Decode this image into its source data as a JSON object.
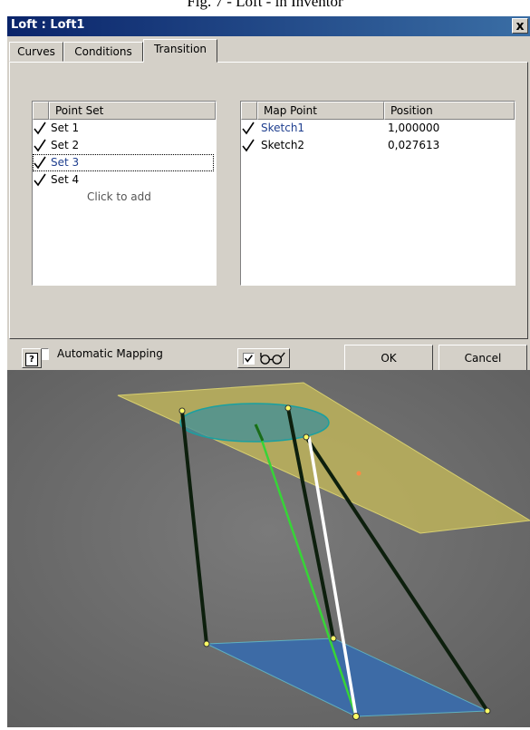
{
  "caption": "Fig. 7 - Loft - in Inventor",
  "window": {
    "title": "Loft : Loft1",
    "close_glyph": "x"
  },
  "tabs": [
    {
      "label": "Curves"
    },
    {
      "label": "Conditions"
    },
    {
      "label": "Transition"
    }
  ],
  "active_tab": "Transition",
  "point_set": {
    "header": "Point Set",
    "items": [
      {
        "label": "Set 1",
        "checked": true
      },
      {
        "label": "Set 2",
        "checked": true
      },
      {
        "label": "Set 3",
        "checked": true,
        "selected": true
      },
      {
        "label": "Set 4",
        "checked": true
      }
    ],
    "add_hint": "Click to add"
  },
  "map_points": {
    "headers": {
      "map_point": "Map Point",
      "position": "Position"
    },
    "rows": [
      {
        "map_point": "Sketch1",
        "position": "1,000000",
        "checked": true
      },
      {
        "map_point": "Sketch2",
        "position": "0,027613",
        "checked": true
      }
    ]
  },
  "automatic_mapping": {
    "label": "Automatic Mapping",
    "checked": false
  },
  "footer": {
    "help_icon": "help-icon",
    "preview_checked": true,
    "preview_icon": "glasses-icon",
    "ok_label": "OK",
    "cancel_label": "Cancel"
  },
  "colors": {
    "titlebar": "#0a246a",
    "dialog_bg": "#d4d0c8",
    "viewport_bg": "#6b6b6b",
    "top_plane": "#bdb35a",
    "bottom_plane": "#3d6ba6",
    "rail_green": "#37d437",
    "rail_dark": "#0d1f0d",
    "rail_white": "#ffffff"
  }
}
